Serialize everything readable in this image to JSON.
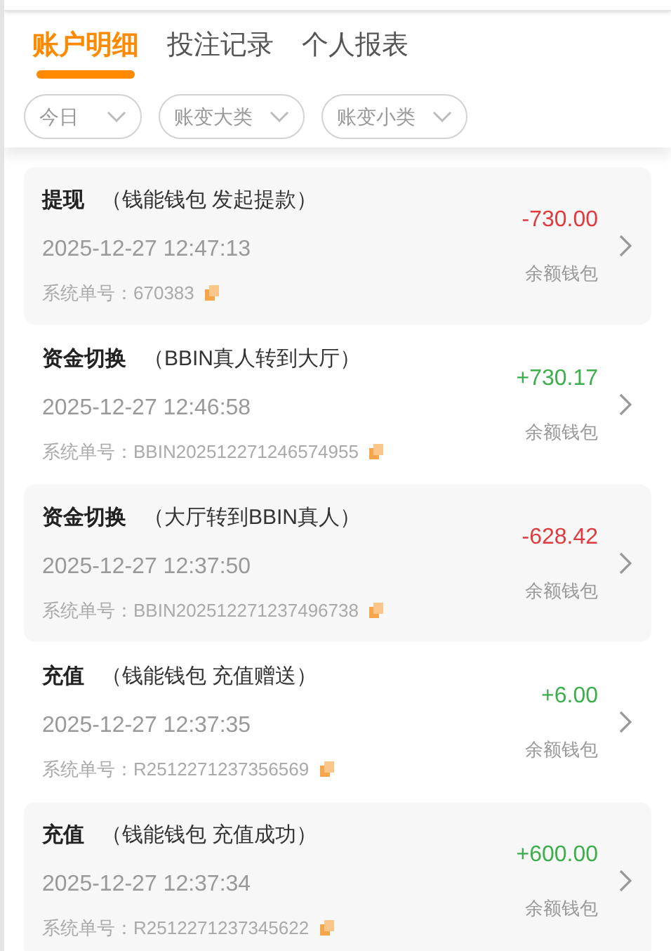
{
  "tabs": [
    {
      "label": "账户明细",
      "selected": true
    },
    {
      "label": "投注记录",
      "selected": false
    },
    {
      "label": "个人报表",
      "selected": false
    }
  ],
  "filters": [
    {
      "label": "今日"
    },
    {
      "label": "账变大类"
    },
    {
      "label": "账变小类"
    }
  ],
  "records": [
    {
      "type": "提现",
      "detail": "（钱能钱包 发起提款）",
      "time": "2025-12-27 12:47:13",
      "order_label": "系统单号：",
      "order": "670383",
      "amount": "-730.00",
      "color": "#e0393e",
      "wallet": "余额钱包"
    },
    {
      "type": "资金切换",
      "detail": "（BBIN真人转到大厅）",
      "time": "2025-12-27 12:46:58",
      "order_label": "系统单号：",
      "order": "BBIN202512271246574955",
      "amount": "+730.17",
      "color": "#3cae4b",
      "wallet": "余额钱包"
    },
    {
      "type": "资金切换",
      "detail": "（大厅转到BBIN真人）",
      "time": "2025-12-27 12:37:50",
      "order_label": "系统单号：",
      "order": "BBIN202512271237496738",
      "amount": "-628.42",
      "color": "#e0393e",
      "wallet": "余额钱包"
    },
    {
      "type": "充值",
      "detail": "（钱能钱包 充值赠送）",
      "time": "2025-12-27 12:37:35",
      "order_label": "系统单号：",
      "order": "R2512271237356569",
      "amount": "+6.00",
      "color": "#3cae4b",
      "wallet": "余额钱包"
    },
    {
      "type": "充值",
      "detail": "（钱能钱包 充值成功）",
      "time": "2025-12-27 12:37:34",
      "order_label": "系统单号：",
      "order": "R2512271237345622",
      "amount": "+600.00",
      "color": "#3cae4b",
      "wallet": "余额钱包"
    }
  ]
}
